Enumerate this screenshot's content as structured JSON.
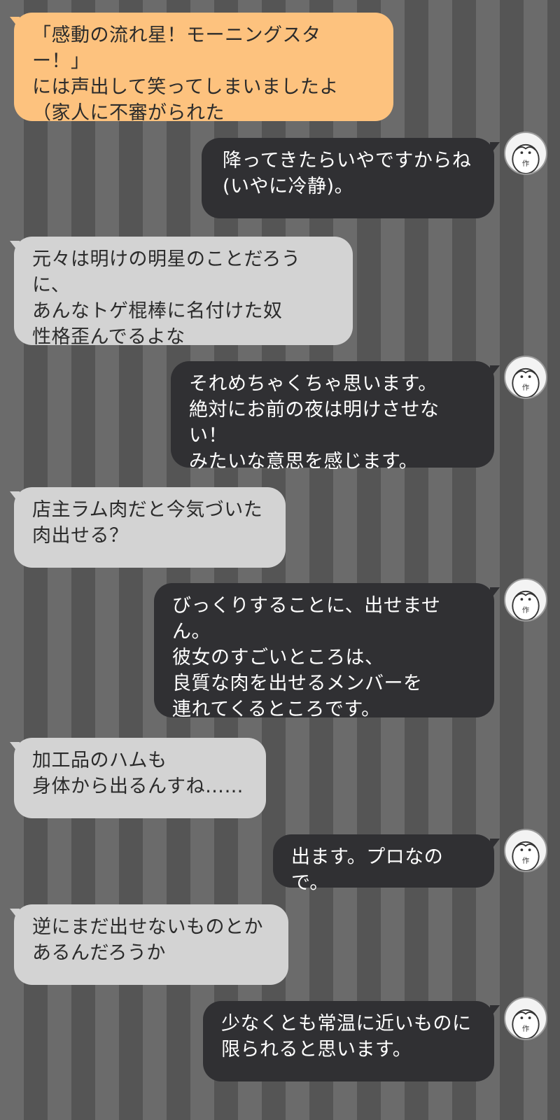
{
  "messages": [
    {
      "side": "left",
      "style": "orange",
      "text": "「感動の流れ星！モーニングスター！」\nには声出して笑ってしまいましたよ\n（家人に不審がられた"
    },
    {
      "side": "right",
      "text": "降ってきたらいやですからね\n(いやに冷静)。"
    },
    {
      "side": "left",
      "text": "元々は明けの明星のことだろうに、\nあんなトゲ棍棒に名付けた奴\n性格歪んでるよな"
    },
    {
      "side": "right",
      "text": "それめちゃくちゃ思います。\n絶対にお前の夜は明けさせない！\nみたいな意思を感じます。"
    },
    {
      "side": "left",
      "text": "店主ラム肉だと今気づいた\n肉出せる？"
    },
    {
      "side": "right",
      "text": "びっくりすることに、出せません。\n彼女のすごいところは、\n良質な肉を出せるメンバーを\n連れてくるところです。"
    },
    {
      "side": "left",
      "text": "加工品のハムも\n身体から出るんすね……"
    },
    {
      "side": "right",
      "text": "出ます。プロなので。"
    },
    {
      "side": "left",
      "text": "逆にまだ出せないものとか\nあるんだろうか"
    },
    {
      "side": "right",
      "text": "少なくとも常温に近いものに\n限られると思います。"
    }
  ],
  "avatar": {
    "icon": "author-avatar-icon",
    "label": "作"
  },
  "colors": {
    "left_bubble": "#d3d3d3",
    "orange_bubble": "#fdc27e",
    "right_bubble": "#303033",
    "stripe_light": "#6b6b6b",
    "stripe_dark": "#555555"
  }
}
